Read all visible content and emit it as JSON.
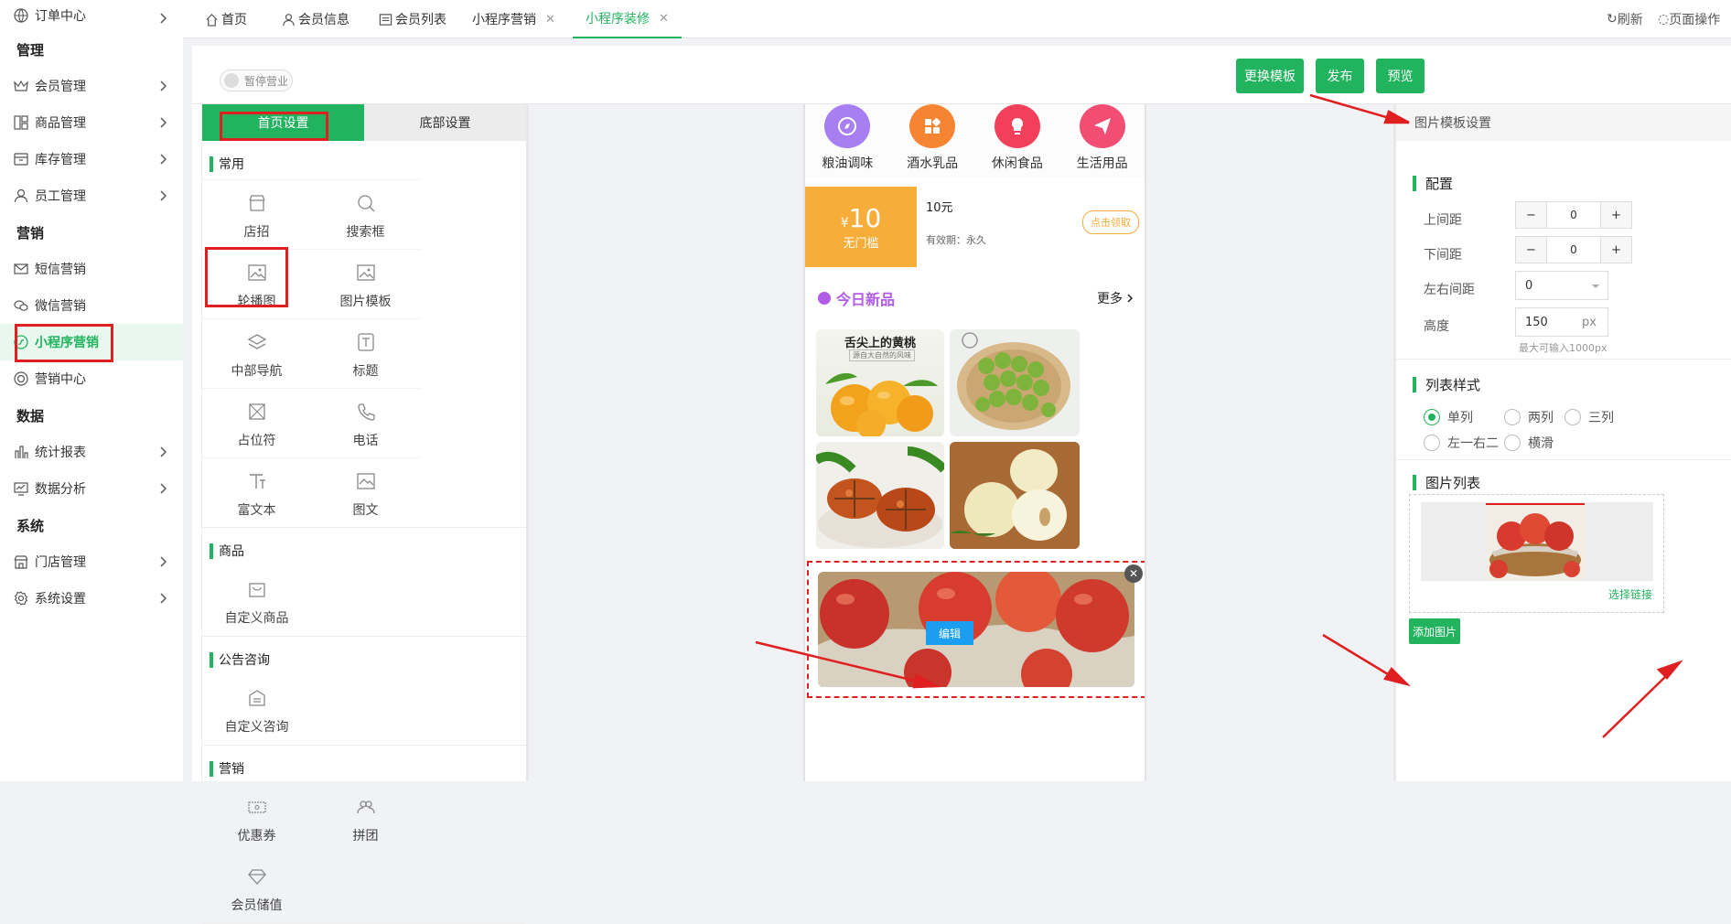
{
  "sidebar": {
    "top_item": "订单中心",
    "groups": [
      {
        "title": "管理",
        "items": [
          "会员管理",
          "商品管理",
          "库存管理",
          "员工管理"
        ]
      },
      {
        "title": "营销",
        "items": [
          "短信营销",
          "微信营销",
          "小程序营销",
          "营销中心"
        ]
      },
      {
        "title": "数据",
        "items": [
          "统计报表",
          "数据分析"
        ]
      },
      {
        "title": "系统",
        "items": [
          "门店管理",
          "系统设置"
        ]
      }
    ]
  },
  "tabs": [
    {
      "label": "首页",
      "icon": "home-icon"
    },
    {
      "label": "会员信息",
      "icon": "user-icon"
    },
    {
      "label": "会员列表",
      "icon": "list-icon"
    },
    {
      "label": "小程序营销",
      "closable": true
    },
    {
      "label": "小程序装修",
      "closable": true,
      "active": true
    }
  ],
  "top_actions": {
    "refresh": "刷新",
    "page_ops": "页面操作"
  },
  "toolbar": {
    "pause_label": "暂停营业",
    "change_template": "更换模板",
    "publish": "发布",
    "preview": "预览"
  },
  "left_panel": {
    "tabs": [
      "首页设置",
      "底部设置"
    ],
    "sections": [
      {
        "title": "常用",
        "items": [
          "店招",
          "搜索框",
          "轮播图",
          "图片模板",
          "中部导航",
          "标题",
          "占位符",
          "电话",
          "富文本",
          "图文"
        ]
      },
      {
        "title": "商品",
        "items": [
          "自定义商品"
        ]
      },
      {
        "title": "公告咨询",
        "items": [
          "自定义咨询"
        ]
      },
      {
        "title": "营销",
        "items": [
          "优惠券",
          "拼团",
          "会员储值"
        ]
      }
    ]
  },
  "phone": {
    "categories": [
      "粮油调味",
      "酒水乳品",
      "休闲食品",
      "生活用品"
    ],
    "coupon": {
      "currency": "¥",
      "amount": "10",
      "threshold": "无门槛",
      "title": "10元",
      "validity": "有效期：永久",
      "claim": "点击领取"
    },
    "new_products": {
      "title": "今日新品",
      "more": "更多"
    },
    "poster_text": "舌尖上的黄桃",
    "poster_sub": "源自大自然的风味",
    "edit_label": "编辑"
  },
  "right_panel": {
    "header": "图片模板设置",
    "config_title": "配置",
    "top_margin_label": "上间距",
    "top_margin_value": "0",
    "bottom_margin_label": "下间距",
    "bottom_margin_value": "0",
    "side_margin_label": "左右间距",
    "side_margin_value": "0",
    "height_label": "高度",
    "height_value": "150",
    "height_unit": "px",
    "height_hint": "最大可输入1000px",
    "list_style_title": "列表样式",
    "list_styles": [
      "单列",
      "两列",
      "三列",
      "左一右二",
      "横滑"
    ],
    "selected_style": "单列",
    "image_list_title": "图片列表",
    "choose_link": "选择链接",
    "add_image": "添加图片"
  },
  "colors": {
    "accent": "#22b35e",
    "highlight": "#e02020",
    "coupon": "#f7ad3a"
  }
}
